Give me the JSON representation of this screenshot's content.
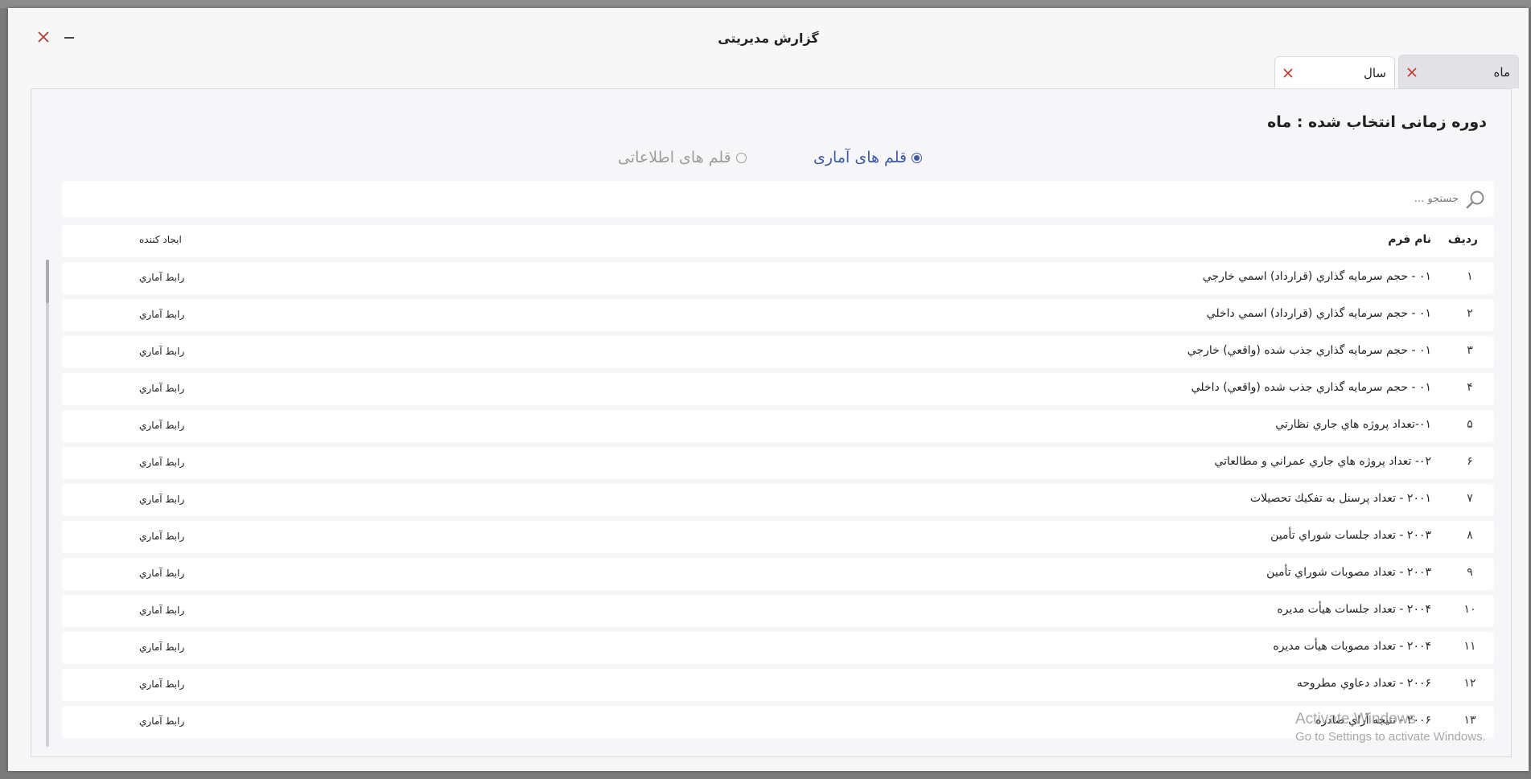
{
  "window": {
    "title": "گزارش مدیریتی"
  },
  "tabs": [
    {
      "label": "ماه",
      "active": true
    },
    {
      "label": "سال",
      "active": false
    }
  ],
  "panel": {
    "period_label": "دوره زمانی انتخاب شده : ماه"
  },
  "radios": {
    "statistical_label": "قلم های آماری",
    "informational_label": "قلم های اطلاعاتی",
    "selected": "statistical"
  },
  "search": {
    "placeholder": "جستجو ..."
  },
  "table": {
    "headers": {
      "row": "ردیف",
      "form_name": "نام فرم",
      "creator": "ایجاد کننده"
    },
    "rows": [
      {
        "num": "۱",
        "name": "۰۱ - حجم سرمايه گذاري (قرارداد) اسمي خارجي",
        "creator": "رابط آماري"
      },
      {
        "num": "۲",
        "name": "۰۱ - حجم سرمايه گذاري (قرارداد) اسمي داخلي",
        "creator": "رابط آماري"
      },
      {
        "num": "۳",
        "name": "۰۱ - حجم سرمايه گذاري جذب شده (واقعي) خارجي",
        "creator": "رابط آماري"
      },
      {
        "num": "۴",
        "name": "۰۱ - حجم سرمايه گذاري جذب شده (واقعي) داخلي",
        "creator": "رابط آماري"
      },
      {
        "num": "۵",
        "name": "۰۱-تعداد پروژه هاي جاري نظارتي",
        "creator": "رابط آماري"
      },
      {
        "num": "۶",
        "name": "۰۲- تعداد پروژه هاي جاري عمراني و مطالعاتي",
        "creator": "رابط آماري"
      },
      {
        "num": "۷",
        "name": "۲۰۰۱ - تعداد پرسنل به تفكيك تحصيلات",
        "creator": "رابط آماري"
      },
      {
        "num": "۸",
        "name": "۲۰۰۳ - تعداد جلسات شوراي تأمين",
        "creator": "رابط آماري"
      },
      {
        "num": "۹",
        "name": "۲۰۰۳ - تعداد مصوبات شوراي تأمين",
        "creator": "رابط آماري"
      },
      {
        "num": "۱۰",
        "name": "۲۰۰۴ - تعداد جلسات هيأت مديره",
        "creator": "رابط آماري"
      },
      {
        "num": "۱۱",
        "name": "۲۰۰۴ - تعداد مصوبات هيأت مديره",
        "creator": "رابط آماري"
      },
      {
        "num": "۱۲",
        "name": "۲۰۰۶ - تعداد دعاوي مطروحه",
        "creator": "رابط آماري"
      },
      {
        "num": "۱۳",
        "name": "۲۰۰۶ - نتيجه آراي صادره",
        "creator": "رابط آماري"
      }
    ]
  },
  "watermark": {
    "line1": "Activate Windows",
    "line2": "Go to Settings to activate Windows."
  },
  "colors": {
    "accent": "#3d5aa8",
    "close_icon": "#c0392b"
  }
}
